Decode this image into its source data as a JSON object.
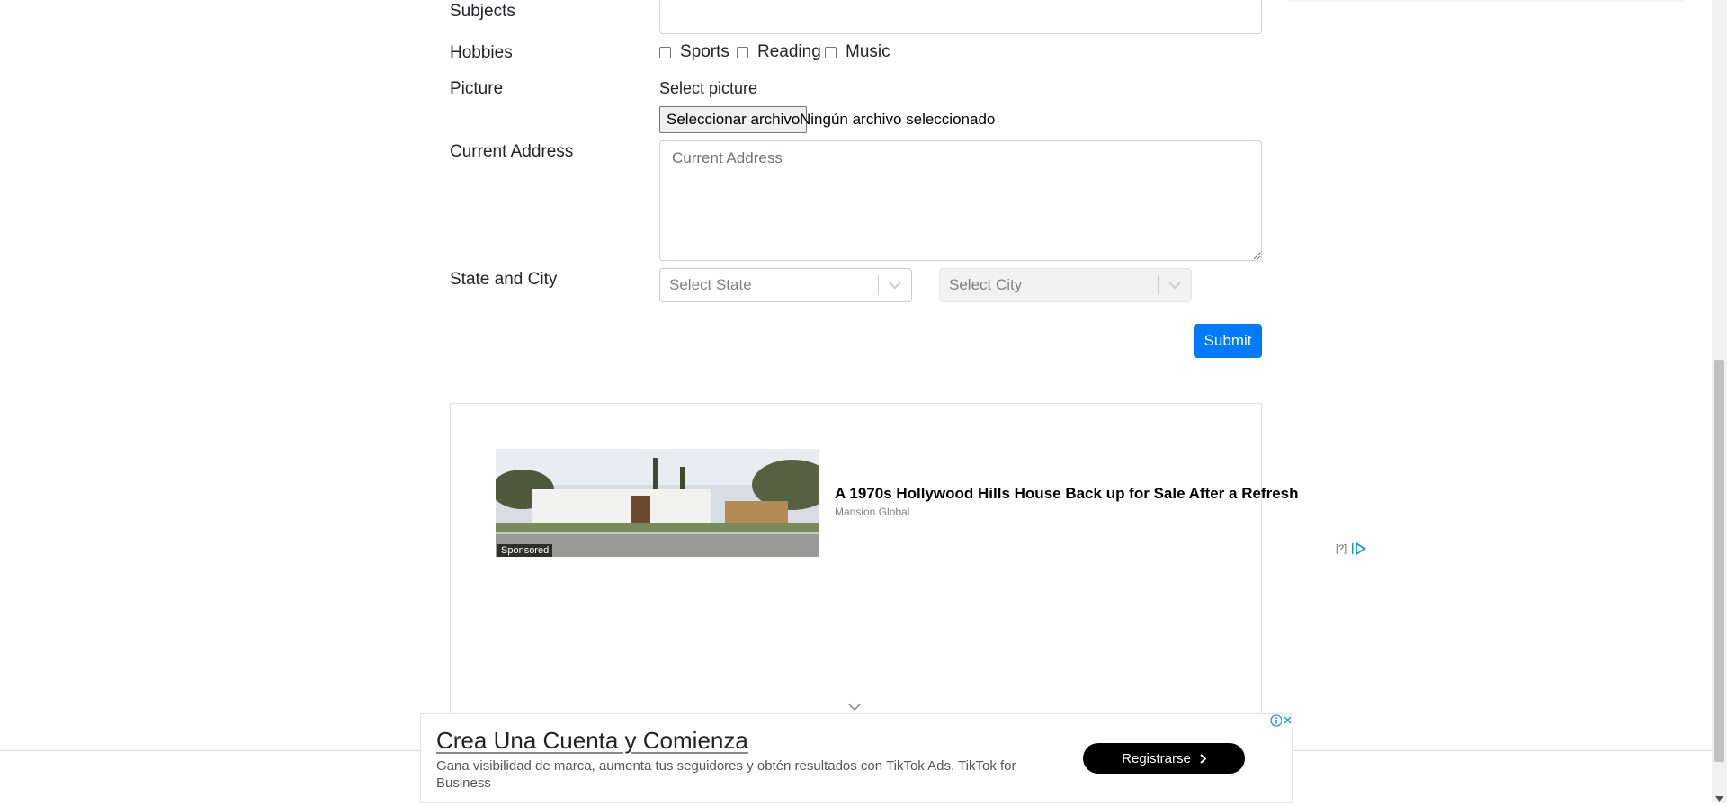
{
  "form": {
    "subjects_label": "Subjects",
    "hobbies_label": "Hobbies",
    "hobbies": [
      {
        "label": "Sports",
        "checked": false
      },
      {
        "label": "Reading",
        "checked": false
      },
      {
        "label": "Music",
        "checked": false
      }
    ],
    "picture_label": "Picture",
    "select_picture_text": "Select picture",
    "file_button_label": "Seleccionar archivo",
    "file_status": "Ningún archivo seleccionado",
    "address_label": "Current Address",
    "address_placeholder": "Current Address",
    "state_city_label": "State and City",
    "state_placeholder": "Select State",
    "city_placeholder": "Select City",
    "submit_label": "Submit"
  },
  "ad_card": {
    "sponsored_label": "Sponsored",
    "title": "A 1970s Hollywood Hills House Back up for Sale After a Refresh",
    "source": "Mansion Global",
    "info_label": "[?]"
  },
  "bottom_ad": {
    "title": "Crea Una Cuenta y Comienza",
    "description": "Gana visibilidad de marca, aumenta tus seguidores y obtén resultados con TikTok Ads. TikTok for Business",
    "button_label": "Registrarse"
  },
  "colors": {
    "primary": "#007bff",
    "text": "#212529",
    "border": "#ced4da"
  },
  "icons": {
    "select_arrow": "chevron-down-icon",
    "ad_info": "info-icon",
    "ad_close": "close-icon",
    "adchoices": "adchoices-icon",
    "button_arrow": "chevron-right-icon"
  }
}
